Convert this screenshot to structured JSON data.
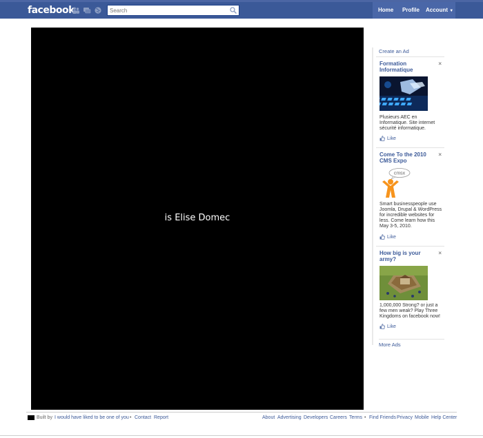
{
  "header": {
    "logo": "facebook",
    "search_placeholder": "Search",
    "nav": {
      "home": "Home",
      "profile": "Profile",
      "account": "Account"
    },
    "account_caret": "▼"
  },
  "stage": {
    "text": "is Elise Domec"
  },
  "ads": {
    "create_ad": "Create an Ad",
    "more_ads": "More Ads",
    "close_glyph": "×",
    "items": [
      {
        "title": "Formation Informatique",
        "body": "Plusieurs AEC en Informatique. Site internet sécurité informatique.",
        "like": "Like"
      },
      {
        "title": "Come To the 2010 CMS Expo",
        "body": "Smart businesspeople use Joomla, Drupal & WordPress for incredible websites for less. Come learn how this May 3-5, 2010.",
        "like": "Like",
        "logo_text": "cmsx"
      },
      {
        "title": "How big is your army?",
        "body": "1,000,000 Strong? or just a few men weak? Play Three Kingdoms on facebook now!",
        "like": "Like"
      }
    ]
  },
  "footer": {
    "built_by": "Built by",
    "author_link": "I would have liked to be one of you",
    "bullet": "•",
    "contact": "Contact",
    "report": "Report",
    "links": [
      "About",
      "Advertising",
      "Developers",
      "Careers",
      "Terms",
      "•",
      "Find Friends",
      "Privacy",
      "Mobile",
      "Help Center"
    ]
  },
  "colors": {
    "brand_blue": "#3b5998",
    "stage_bg": "#000000",
    "link_blue": "#3b5998"
  },
  "icons": {
    "friends": "friends-icon",
    "messages": "messages-icon",
    "notifications": "globe-icon",
    "search": "search-icon",
    "like": "thumbs-up-icon",
    "close": "close-icon"
  }
}
